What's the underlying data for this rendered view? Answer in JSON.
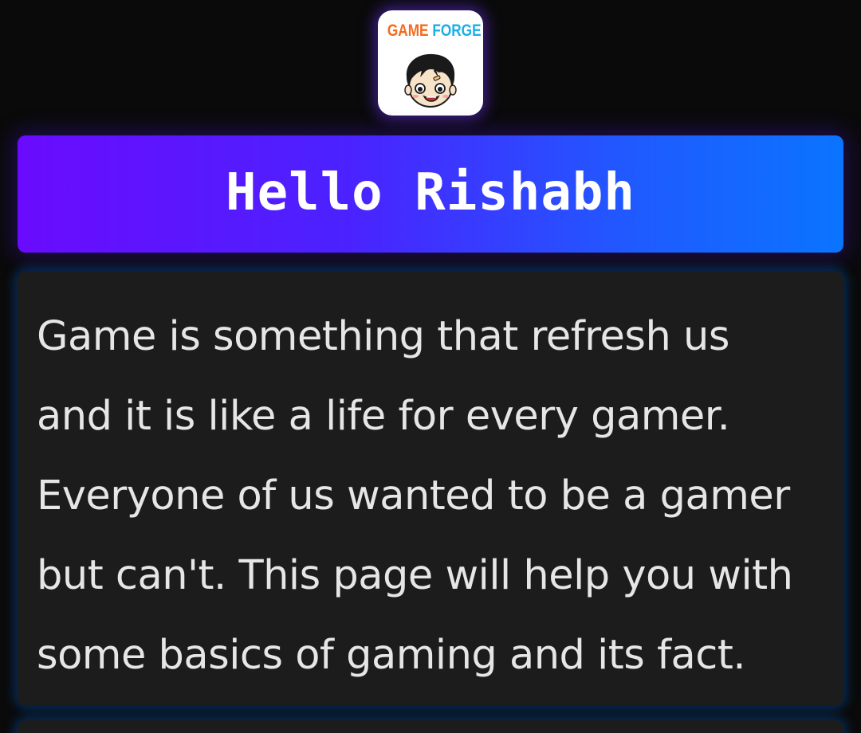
{
  "logo": {
    "word_1": "GAME",
    "word_2": "FORGE",
    "icon": "cartoon-boy-face",
    "colors": {
      "word_1": "#f26b1d",
      "word_2": "#1ab0e6"
    }
  },
  "banner": {
    "title": "Hello Rishabh",
    "gradient": [
      "#6a0bfe",
      "#0a74ff"
    ]
  },
  "intro": {
    "lines": [
      "Game is something that refresh us",
      "and it is like a life for every gamer.",
      "Everyone of us wanted to be a gamer",
      "but can't. This page will help you with",
      "some basics of gaming and its fact."
    ]
  },
  "theme": {
    "background": "#0a0a0a",
    "card": "#1c1c1c",
    "text": "#e6e6e6",
    "glow_blue": "#005abe",
    "glow_purple": "#6e32ff"
  }
}
